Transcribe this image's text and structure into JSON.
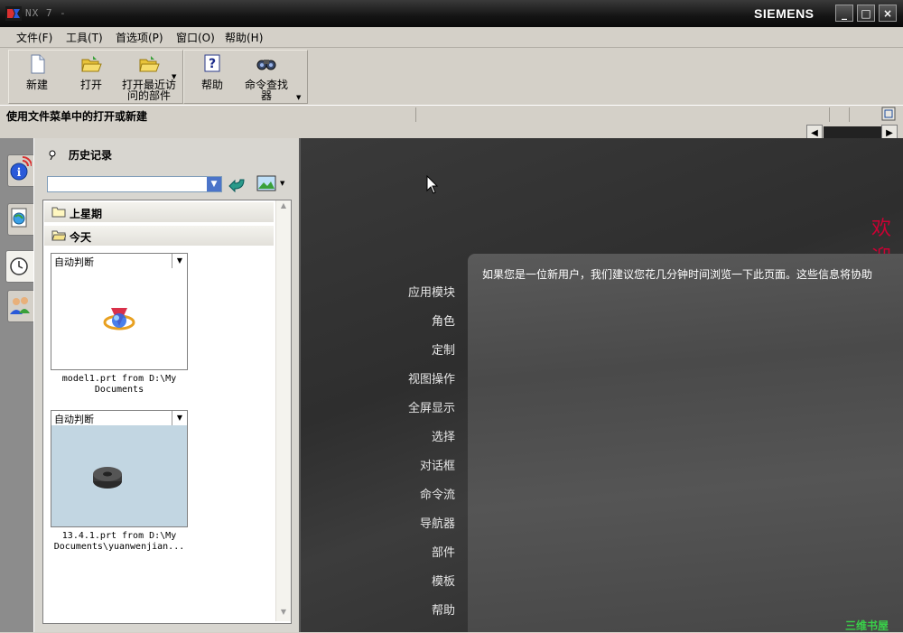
{
  "window": {
    "title": "NX 7 -",
    "brand": "SIEMENS",
    "controls": [
      "_",
      "□",
      "×"
    ]
  },
  "menu": {
    "items": [
      "文件(F)",
      "工具(T)",
      "首选项(P)",
      "窗口(O)",
      "帮助(H)"
    ]
  },
  "toolbar": {
    "new_label": "新建",
    "open_label": "打开",
    "recent_label_1": "打开最近访",
    "recent_label_2": "问的部件",
    "help_label": "帮助",
    "finder_label_1": "命令查找",
    "finder_label_2": "器"
  },
  "status": {
    "text": "使用文件菜单中的打开或新建"
  },
  "resource_panel": {
    "title": "历史记录",
    "combo_value": "",
    "groups": {
      "last_week": "上星期",
      "today": "今天"
    },
    "files": [
      {
        "mode": "自动判断",
        "caption_line1": "model1.prt from D:\\My",
        "caption_line2": "Documents"
      },
      {
        "mode": "自动判断",
        "caption_line1": "13.4.1.prt from D:\\My",
        "caption_line2": "Documents\\yuanwenjian..."
      }
    ]
  },
  "welcome": {
    "title": "欢迎",
    "intro": "如果您是一位新用户，我们建议您花几分钟时间浏览一下此页面。这些信息将协助",
    "nav": [
      "应用模块",
      "角色",
      "定制",
      "视图操作",
      "全屏显示",
      "选择",
      "对话框",
      "命令流",
      "导航器",
      "部件",
      "模板",
      "帮助"
    ]
  },
  "watermark": "三维书屋",
  "colors": {
    "title_bar": "#141414",
    "accent_red": "#cc0033",
    "panel_bg": "#d8d6d0",
    "main_bg": "#2a2a2a",
    "watermark": "#39d049"
  }
}
